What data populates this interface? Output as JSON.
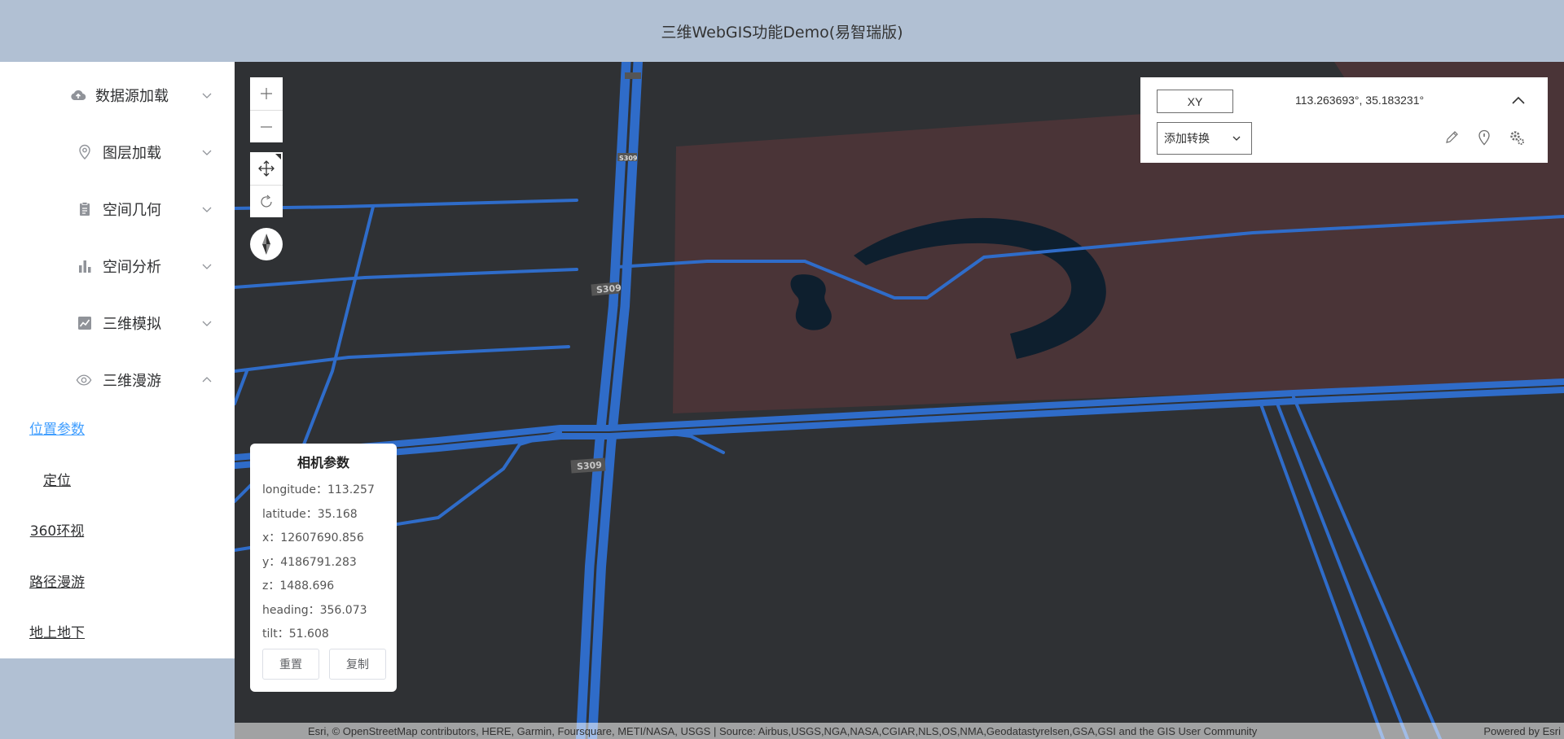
{
  "header": {
    "title": "三维WebGIS功能Demo(易智瑞版)"
  },
  "sidebar": {
    "menu": [
      {
        "label": "数据源加载",
        "icon": "cloud-upload-icon",
        "expanded": false
      },
      {
        "label": "图层加载",
        "icon": "location-pin-icon",
        "expanded": false
      },
      {
        "label": "空间几何",
        "icon": "clipboard-icon",
        "expanded": false
      },
      {
        "label": "空间分析",
        "icon": "bar-chart-icon",
        "expanded": false
      },
      {
        "label": "三维模拟",
        "icon": "line-chart-icon",
        "expanded": false
      },
      {
        "label": "三维漫游",
        "icon": "eye-icon",
        "expanded": true
      }
    ],
    "submenu": [
      {
        "label": "位置参数",
        "active": true
      },
      {
        "label": "定位",
        "active": false
      },
      {
        "label": "360环视",
        "active": false
      },
      {
        "label": "路径漫游",
        "active": false
      },
      {
        "label": "地上地下",
        "active": false
      }
    ]
  },
  "map_controls": {
    "zoom_in": "zoom-in-icon",
    "zoom_out": "zoom-out-icon",
    "pan": "pan-icon",
    "rotate": "rotate-icon",
    "compass": "compass-icon"
  },
  "coordinate_widget": {
    "mode_label": "XY",
    "coordinates": "113.263693°, 35.183231°",
    "convert_label": "添加转换",
    "tools": [
      "pencil-icon",
      "map-marker-icon",
      "settings-icon"
    ]
  },
  "camera_panel": {
    "title": "相机参数",
    "params": [
      {
        "key": "longitude",
        "value": "113.257"
      },
      {
        "key": "latitude",
        "value": "35.168"
      },
      {
        "key": "x",
        "value": "12607690.856"
      },
      {
        "key": "y",
        "value": "4186791.283"
      },
      {
        "key": "z",
        "value": "1488.696"
      },
      {
        "key": "heading",
        "value": "356.073"
      },
      {
        "key": "tilt",
        "value": "51.608"
      }
    ],
    "reset_label": "重置",
    "copy_label": "复制"
  },
  "map_labels": {
    "road_shield": "S309"
  },
  "attribution": {
    "text": "Esri, © OpenStreetMap contributors, HERE, Garmin, Foursquare, METI/NASA, USGS | Source: Airbus,USGS,NGA,NASA,CGIAR,NLS,OS,NMA,Geodatastyrelsen,GSA,GSI and the GIS User Community",
    "powered": "Powered by Esri"
  },
  "colors": {
    "header_bg": "#b1c0d3",
    "map_bg": "#2f3134",
    "road": "#2f6cc9",
    "landuse": "#4a3437",
    "accent": "#409eff"
  }
}
